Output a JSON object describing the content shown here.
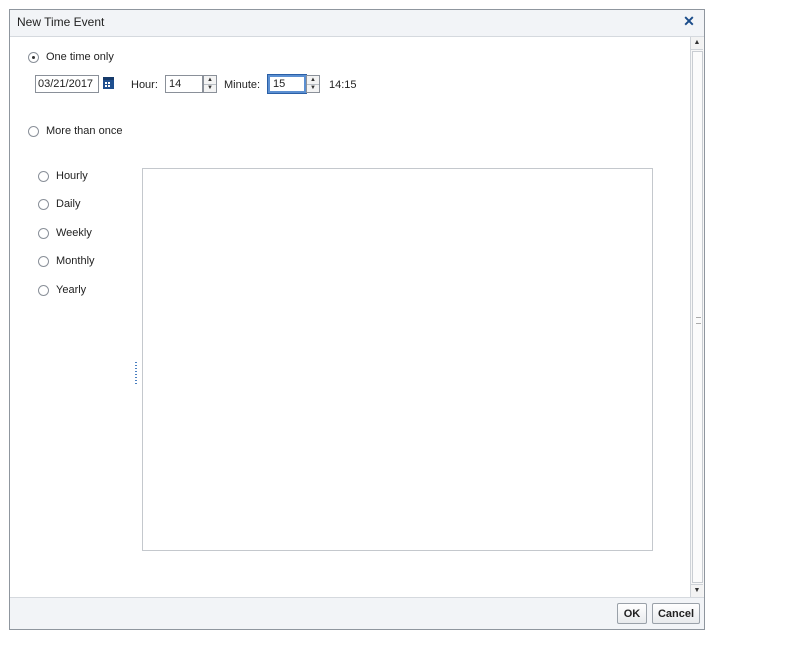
{
  "dialog": {
    "title": "New Time Event",
    "close_glyph": "✕"
  },
  "schedule": {
    "one_time_label": "One time only",
    "one_time_selected": true,
    "more_than_once_label": "More than once",
    "more_than_once_selected": false
  },
  "date": {
    "value": "03/21/2017",
    "icon": "calendar-icon"
  },
  "hour": {
    "label": "Hour:",
    "value": "14"
  },
  "minute": {
    "label": "Minute:",
    "value": "15"
  },
  "time_readout": "14:15",
  "recurrence": {
    "options": [
      {
        "label": "Hourly",
        "selected": false
      },
      {
        "label": "Daily",
        "selected": false
      },
      {
        "label": "Weekly",
        "selected": false
      },
      {
        "label": "Monthly",
        "selected": false
      },
      {
        "label": "Yearly",
        "selected": false
      }
    ]
  },
  "footer": {
    "ok_label": "OK",
    "cancel_label": "Cancel"
  },
  "colors": {
    "accent": "#1b4c8a",
    "focus": "#5b8fd1",
    "titlebar": "#f2f4f7"
  }
}
